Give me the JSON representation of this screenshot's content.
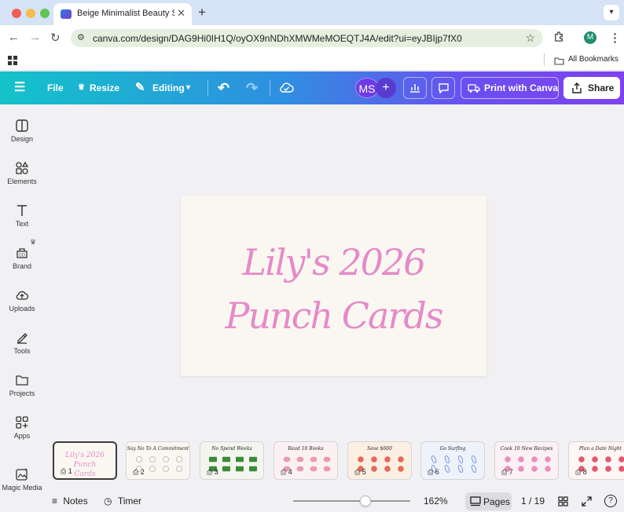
{
  "browser": {
    "tab_title": "Beige Minimalist Beauty Spa",
    "url": "canva.com/design/DAG9Hi0IH1Q/oyOX9nNDhXMWMeMOEQTJ4A/edit?ui=eyJBIjp7fX0",
    "profile_initial": "M",
    "bookmarks_label": "All Bookmarks"
  },
  "header": {
    "file": "File",
    "resize": "Resize",
    "editing": "Editing",
    "avatar_initials": "MS",
    "print": "Print with Canva",
    "share": "Share"
  },
  "sidebar": {
    "items": [
      {
        "label": "Design"
      },
      {
        "label": "Elements"
      },
      {
        "label": "Text"
      },
      {
        "label": "Brand"
      },
      {
        "label": "Uploads"
      },
      {
        "label": "Tools"
      },
      {
        "label": "Projects"
      },
      {
        "label": "Apps"
      },
      {
        "label": "Magic Media"
      }
    ]
  },
  "canvas": {
    "line1": "Lily's 2026",
    "line2": "Punch Cards"
  },
  "pages": [
    {
      "num": "1",
      "caption": "Lily's 2026 Punch Cards"
    },
    {
      "num": "2",
      "caption": "Say No To A Commitment"
    },
    {
      "num": "3",
      "caption": "No Spend Weeks"
    },
    {
      "num": "4",
      "caption": "Read 10 Books"
    },
    {
      "num": "5",
      "caption": "Save $600"
    },
    {
      "num": "6",
      "caption": "Go Surfing"
    },
    {
      "num": "7",
      "caption": "Cook 10 New Recipes"
    },
    {
      "num": "8",
      "caption": "Plan a Date Night"
    }
  ],
  "bottombar": {
    "notes": "Notes",
    "timer": "Timer",
    "zoom": "162%",
    "pages_label": "Pages",
    "page_counter": "1 / 19",
    "zoom_level": 0.62
  },
  "colors": {
    "title_pink": "#e58ac9",
    "card_bg": "#faf7f1",
    "header_start": "#13c3c9",
    "header_end": "#7e42ef"
  }
}
